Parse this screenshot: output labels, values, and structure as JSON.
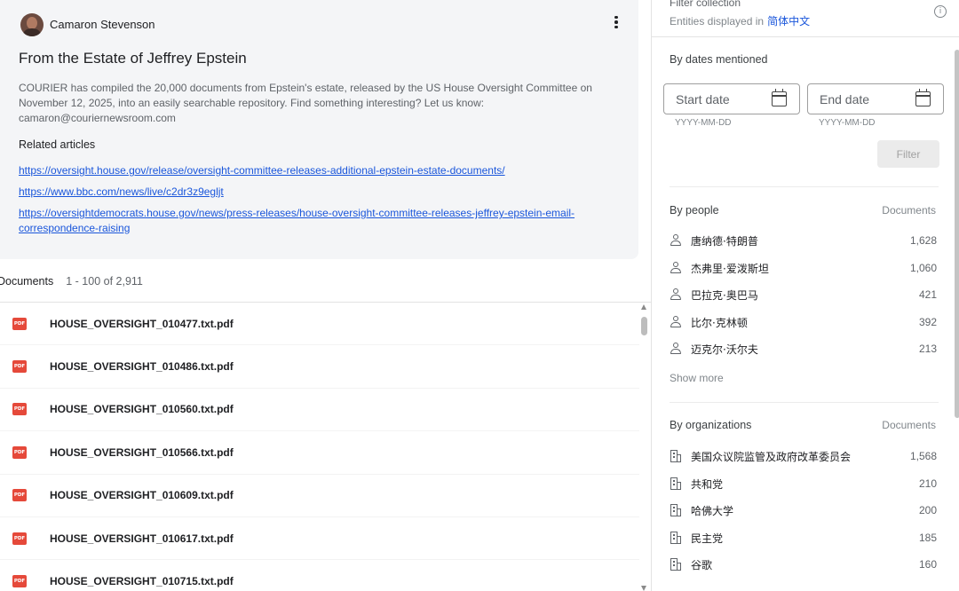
{
  "author": {
    "name": "Camaron Stevenson"
  },
  "card": {
    "title": "From the Estate of Jeffrey Epstein",
    "description": "COURIER has compiled the 20,000 documents from Epstein's estate, released by the US House Oversight Committee on November 12, 2025, into an easily searchable repository. Find something interesting? Let us know: camaron@couriernewsroom.com",
    "related_heading": "Related articles",
    "links": [
      "https://oversight.house.gov/release/oversight-committee-releases-additional-epstein-estate-documents/",
      "https://www.bbc.com/news/live/c2dr3z9egljt",
      "https://oversightdemocrats.house.gov/news/press-releases/house-oversight-committee-releases-jeffrey-epstein-email-correspondence-raising"
    ]
  },
  "documents": {
    "label": "Documents",
    "range": "1 - 100 of 2,911",
    "icon_text": "PDF",
    "files": [
      "HOUSE_OVERSIGHT_010477.txt.pdf",
      "HOUSE_OVERSIGHT_010486.txt.pdf",
      "HOUSE_OVERSIGHT_010560.txt.pdf",
      "HOUSE_OVERSIGHT_010566.txt.pdf",
      "HOUSE_OVERSIGHT_010609.txt.pdf",
      "HOUSE_OVERSIGHT_010617.txt.pdf",
      "HOUSE_OVERSIGHT_010715.txt.pdf"
    ]
  },
  "filter": {
    "title": "Filter collection",
    "entities_prefix": "Entities displayed in",
    "language": "简体中文",
    "info_icon": "i",
    "dates": {
      "title": "By dates mentioned",
      "start_placeholder": "Start date",
      "end_placeholder": "End date",
      "start_hint": "YYYY-MM-DD",
      "end_hint": "YYYY-MM-DD",
      "filter_button": "Filter"
    },
    "people": {
      "title": "By people",
      "column": "Documents",
      "items": [
        {
          "name": "唐纳德·特朗普",
          "count": "1,628"
        },
        {
          "name": "杰弗里·爱泼斯坦",
          "count": "1,060"
        },
        {
          "name": "巴拉克·奥巴马",
          "count": "421"
        },
        {
          "name": "比尔·克林顿",
          "count": "392"
        },
        {
          "name": "迈克尔·沃尔夫",
          "count": "213"
        }
      ],
      "show_more": "Show more"
    },
    "organizations": {
      "title": "By organizations",
      "column": "Documents",
      "items": [
        {
          "name": "美国众议院监管及政府改革委员会",
          "count": "1,568"
        },
        {
          "name": "共和党",
          "count": "210"
        },
        {
          "name": "哈佛大学",
          "count": "200"
        },
        {
          "name": "民主党",
          "count": "185"
        },
        {
          "name": "谷歌",
          "count": "160"
        }
      ]
    }
  },
  "icons": {
    "kebab": "more-vert-icon",
    "calendar": "calendar-icon",
    "person": "person-icon",
    "organization": "building-icon",
    "pdf": "pdf-icon",
    "info": "info-icon"
  },
  "colors": {
    "link": "#1a56db",
    "pdf": "#e5493a",
    "card_bg": "#f4f5f7"
  }
}
